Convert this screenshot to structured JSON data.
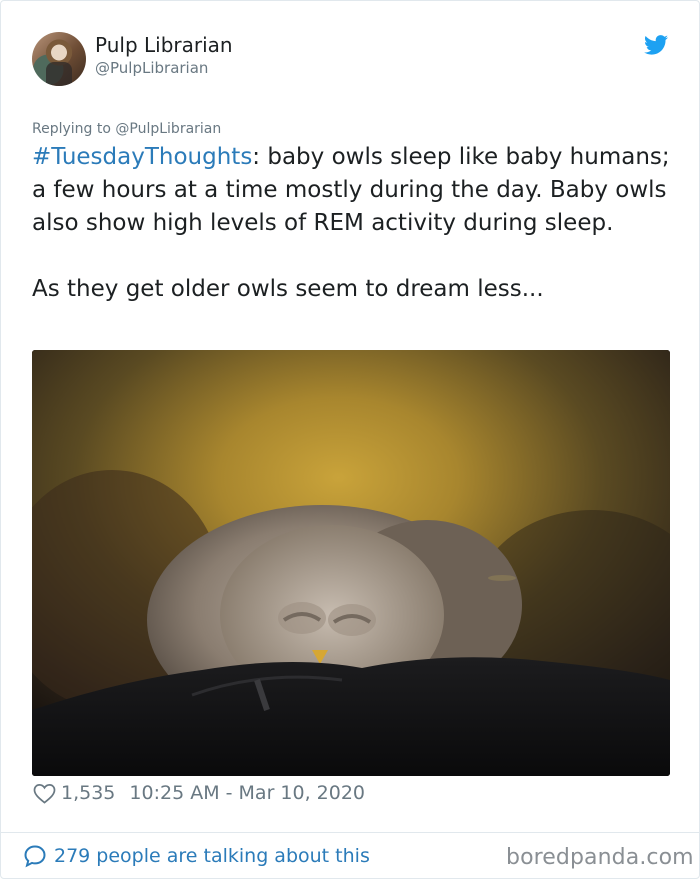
{
  "author": {
    "name": "Pulp Librarian",
    "handle": "@PulpLibrarian",
    "avatar_icon": "user-avatar-photo"
  },
  "brand": {
    "icon": "twitter-bird-icon",
    "color": "#1da1f2"
  },
  "reply": {
    "prefix": "Replying to",
    "handle": "@PulpLibrarian"
  },
  "tweet": {
    "hashtag": "#TuesdayThoughts",
    "text_after_hashtag": ": baby owls sleep like baby humans; a few hours at a time mostly during the day. Baby owls also show high levels of REM activity during sleep.",
    "second_paragraph": "As they get older owls seem to dream less..."
  },
  "media": {
    "subject": "sleeping baby owl resting on dark jacket",
    "icon": "owl-photo"
  },
  "meta": {
    "likes": "1,535",
    "timestamp": "10:25 AM - Mar 10, 2020"
  },
  "footer": {
    "talking_text": "279 people are talking about this",
    "watermark": "boredpanda.com"
  },
  "colors": {
    "link": "#2b7bb9",
    "muted": "#697882",
    "text": "#1c2022"
  }
}
